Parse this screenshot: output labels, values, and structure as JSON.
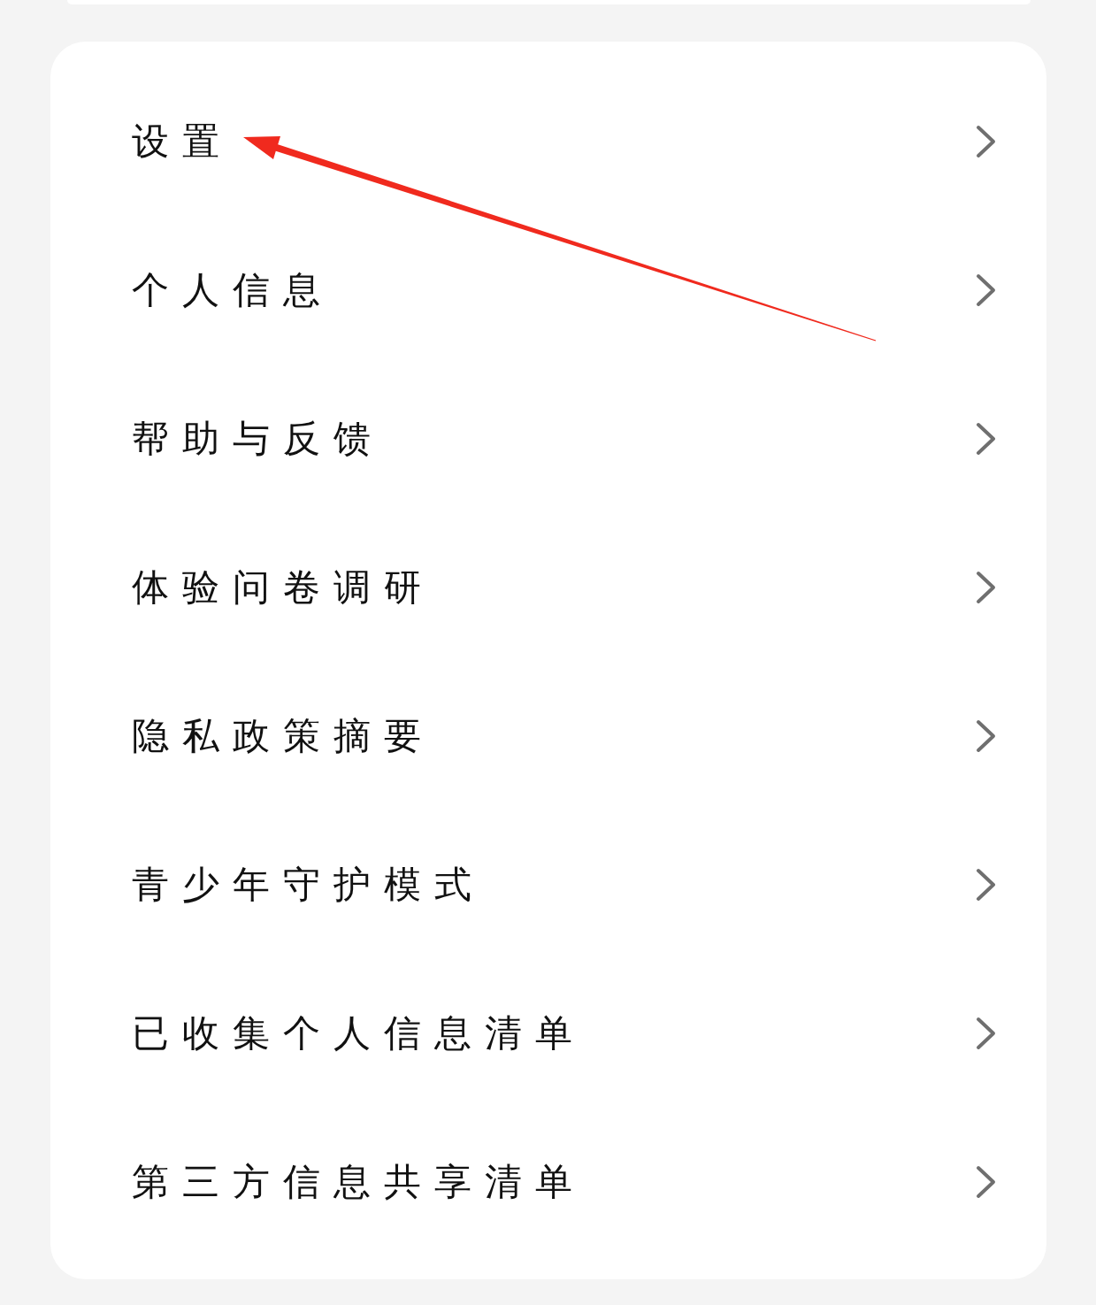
{
  "menu": {
    "items": [
      {
        "label": "设置"
      },
      {
        "label": "个人信息"
      },
      {
        "label": "帮助与反馈"
      },
      {
        "label": "体验问卷调研"
      },
      {
        "label": "隐私政策摘要"
      },
      {
        "label": "青少年守护模式"
      },
      {
        "label": "已收集个人信息清单"
      },
      {
        "label": "第三方信息共享清单"
      }
    ]
  }
}
